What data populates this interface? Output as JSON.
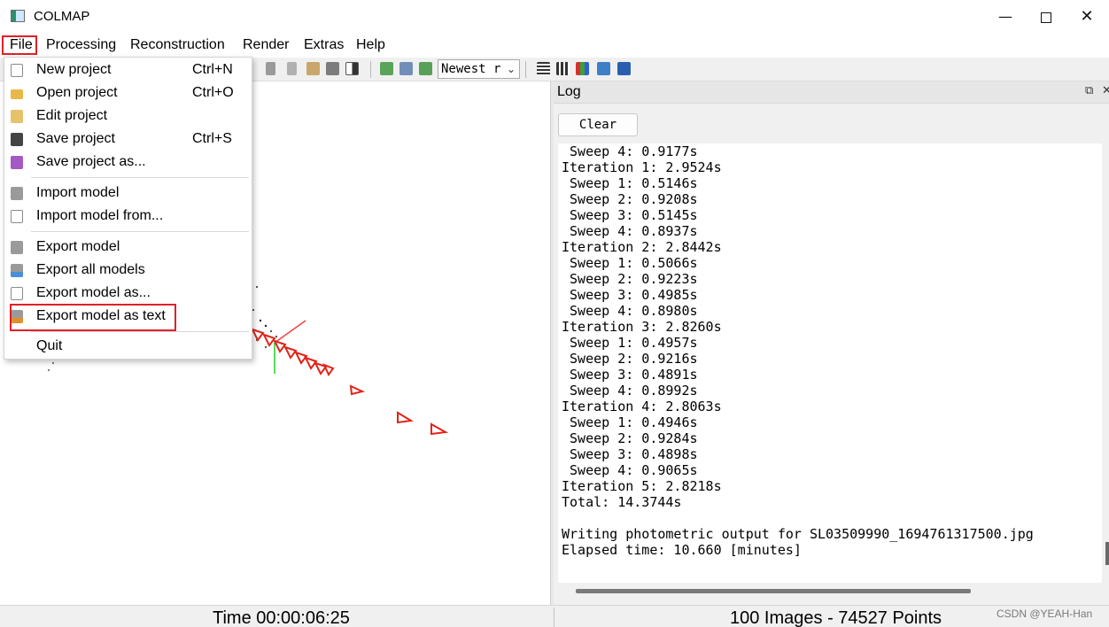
{
  "window": {
    "title": "COLMAP",
    "controls": [
      "minimize-icon",
      "maximize-icon",
      "close-icon"
    ]
  },
  "menubar": {
    "items": [
      "File",
      "Processing",
      "Reconstruction",
      "Render",
      "Extras",
      "Help"
    ]
  },
  "toolbar": {
    "sort_combo_value": "Newest r"
  },
  "file_menu": {
    "items": [
      {
        "label": "New project",
        "shortcut": "Ctrl+N",
        "icon": "new-file-icon"
      },
      {
        "label": "Open project",
        "shortcut": "Ctrl+O",
        "icon": "folder-icon"
      },
      {
        "label": "Edit project",
        "shortcut": "",
        "icon": "edit-icon"
      },
      {
        "label": "Save project",
        "shortcut": "Ctrl+S",
        "icon": "save-icon"
      },
      {
        "label": "Save project as...",
        "shortcut": "",
        "icon": "save-as-icon"
      },
      {
        "label": "Import model",
        "shortcut": "",
        "icon": "import-icon"
      },
      {
        "label": "Import model from...",
        "shortcut": "",
        "icon": "import-from-icon"
      },
      {
        "label": "Export model",
        "shortcut": "",
        "icon": "export-icon"
      },
      {
        "label": "Export all models",
        "shortcut": "",
        "icon": "export-all-icon"
      },
      {
        "label": "Export model as...",
        "shortcut": "",
        "icon": "export-as-icon"
      },
      {
        "label": "Export model as text",
        "shortcut": "",
        "icon": "export-text-icon"
      },
      {
        "label": "Quit",
        "shortcut": "",
        "icon": ""
      }
    ],
    "highlighted": "Export model as text"
  },
  "log": {
    "title": "Log",
    "clear_label": "Clear",
    "lines": [
      " Sweep 4: 0.9177s",
      "Iteration 1: 2.9524s",
      " Sweep 1: 0.5146s",
      " Sweep 2: 0.9208s",
      " Sweep 3: 0.5145s",
      " Sweep 4: 0.8937s",
      "Iteration 2: 2.8442s",
      " Sweep 1: 0.5066s",
      " Sweep 2: 0.9223s",
      " Sweep 3: 0.4985s",
      " Sweep 4: 0.8980s",
      "Iteration 3: 2.8260s",
      " Sweep 1: 0.4957s",
      " Sweep 2: 0.9216s",
      " Sweep 3: 0.4891s",
      " Sweep 4: 0.8992s",
      "Iteration 4: 2.8063s",
      " Sweep 1: 0.4946s",
      " Sweep 2: 0.9284s",
      " Sweep 3: 0.4898s",
      " Sweep 4: 0.9065s",
      "Iteration 5: 2.8218s",
      "Total: 14.3744s",
      "",
      "Writing photometric output for SL03509990_1694761317500.jpg",
      "Elapsed time: 10.660 [minutes]"
    ]
  },
  "status": {
    "time": "Time 00:00:06:25",
    "points": "100 Images - 74527 Points"
  },
  "watermark": "CSDN @YEAH-Han",
  "colors": {
    "highlight_box": "#e0202a",
    "camera_red": "#e02418"
  }
}
